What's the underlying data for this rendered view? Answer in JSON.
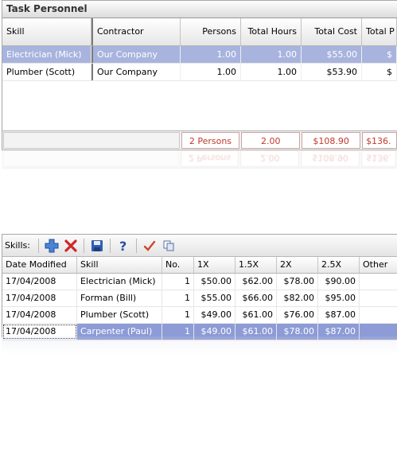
{
  "task_personnel": {
    "title": "Task Personnel",
    "columns": [
      "Skill",
      "Contractor",
      "Persons",
      "Total Hours",
      "Total Cost",
      "Total P"
    ],
    "rows": [
      {
        "skill": "Electrician (Mick)",
        "contractor": "Our Company",
        "persons": "1.00",
        "hours": "1.00",
        "cost": "$55.00",
        "totalp": "$",
        "selected": true
      },
      {
        "skill": "Plumber (Scott)",
        "contractor": "Our Company",
        "persons": "1.00",
        "hours": "1.00",
        "cost": "$53.90",
        "totalp": "$",
        "selected": false
      }
    ],
    "footer": {
      "persons": "2 Persons",
      "hours": "2.00",
      "cost": "$108.90",
      "totalp": "$136."
    }
  },
  "skills": {
    "label": "Skills:",
    "toolbar_icons": [
      "add-icon",
      "delete-icon",
      "save-icon",
      "help-icon",
      "check-icon",
      "copy-icon"
    ],
    "columns": [
      "Date Modified",
      "Skill",
      "No.",
      "1X",
      "1.5X",
      "2X",
      "2.5X",
      "Other"
    ],
    "rows": [
      {
        "date": "17/04/2008",
        "skill": "Electrician (Mick)",
        "no": "1",
        "x1": "$50.00",
        "x15": "$62.00",
        "x2": "$78.00",
        "x25": "$90.00",
        "other": ""
      },
      {
        "date": "17/04/2008",
        "skill": "Forman (Bill)",
        "no": "1",
        "x1": "$55.00",
        "x15": "$66.00",
        "x2": "$82.00",
        "x25": "$95.00",
        "other": ""
      },
      {
        "date": "17/04/2008",
        "skill": "Plumber (Scott)",
        "no": "1",
        "x1": "$49.00",
        "x15": "$61.00",
        "x2": "$76.00",
        "x25": "$87.00",
        "other": ""
      },
      {
        "date": "17/04/2008",
        "skill": "Carpenter (Paul)",
        "no": "1",
        "x1": "$49.00",
        "x15": "$61.00",
        "x2": "$78.00",
        "x25": "$87.00",
        "other": ""
      }
    ]
  },
  "colors": {
    "selection": "#a8b4de",
    "selection_dark": "#8d9bd6",
    "total_text": "#c0392b"
  }
}
